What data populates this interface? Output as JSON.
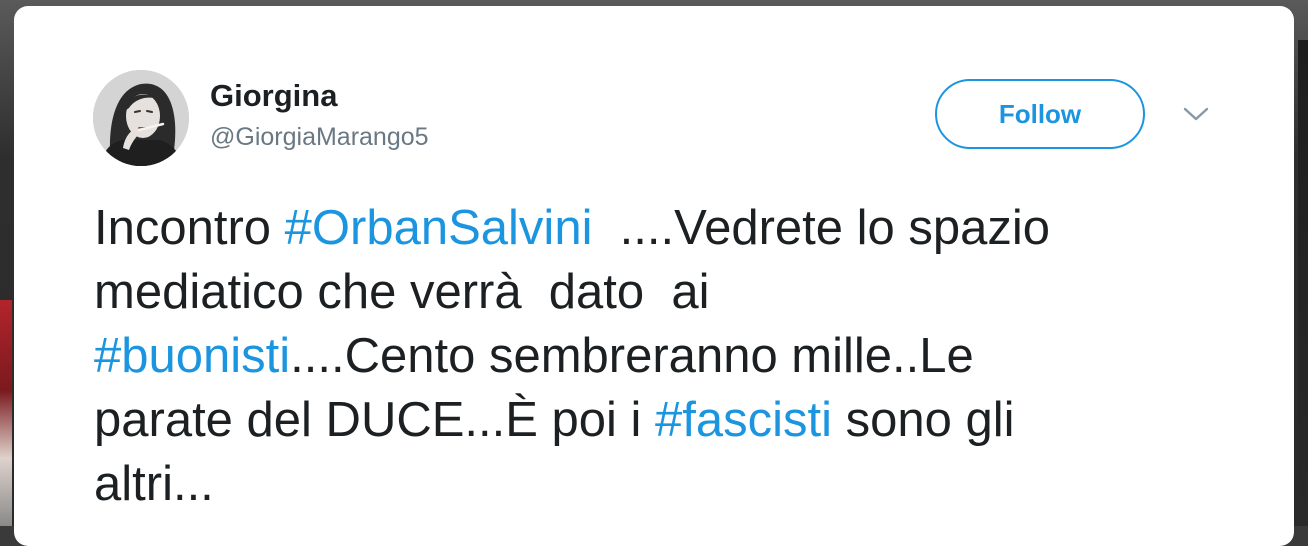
{
  "author": {
    "name": "Giorgina",
    "handle": "@GiorgiaMarango5"
  },
  "actions": {
    "follow_label": "Follow"
  },
  "colors": {
    "link": "#1b95e0",
    "text": "#1c2022",
    "muted": "#697882"
  },
  "icons": {
    "menu": "chevron-down-icon"
  },
  "tweet": {
    "lines": [
      [
        {
          "text": "Incontro ",
          "hashtag": false
        },
        {
          "text": "#OrbanSalvini",
          "hashtag": true
        },
        {
          "text": "  ....Vedrete lo spazio",
          "hashtag": false
        }
      ],
      [
        {
          "text": "mediatico che verrà  dato  ai",
          "hashtag": false
        }
      ],
      [
        {
          "text": "#buonisti",
          "hashtag": true
        },
        {
          "text": "....Cento sembreranno mille..Le",
          "hashtag": false
        }
      ],
      [
        {
          "text": "parate del DUCE...È poi i ",
          "hashtag": false
        },
        {
          "text": "#fascisti",
          "hashtag": true
        },
        {
          "text": " sono gli",
          "hashtag": false
        }
      ],
      [
        {
          "text": "altri...",
          "hashtag": false
        }
      ]
    ]
  }
}
